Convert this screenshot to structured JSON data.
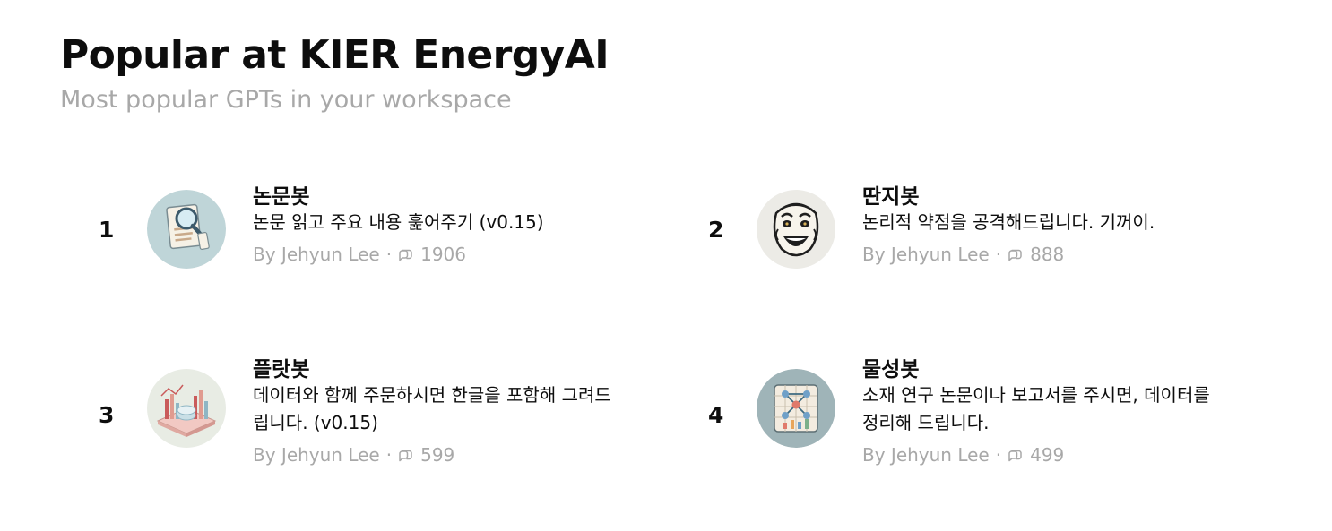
{
  "header": {
    "title": "Popular at KIER EnergyAI",
    "subtitle": "Most popular GPTs in your workspace"
  },
  "gpts": [
    {
      "rank": "1",
      "name": "논문봇",
      "description": "논문 읽고 주요 내용 훑어주기 (v0.15)",
      "author": "By Jehyun Lee",
      "separator": "·",
      "conversations": "1906",
      "icon": "magnifier-document-icon"
    },
    {
      "rank": "2",
      "name": "딴지봇",
      "description": "논리적 약점을 공격해드립니다. 기꺼이.",
      "author": "By Jehyun Lee",
      "separator": "·",
      "conversations": "888",
      "icon": "grinning-mask-icon"
    },
    {
      "rank": "3",
      "name": "플랏봇",
      "description": "데이터와 함께 주문하시면 한글을 포함해 그려드립니다. (v0.15)",
      "author": "By Jehyun Lee",
      "separator": "·",
      "conversations": "599",
      "icon": "bar-chart-isometric-icon"
    },
    {
      "rank": "4",
      "name": "물성봇",
      "description": "소재 연구 논문이나 보고서를 주시면, 데이터를 정리해 드립니다.",
      "author": "By Jehyun Lee",
      "separator": "·",
      "conversations": "499",
      "icon": "molecule-chart-icon"
    }
  ],
  "colors": {
    "text": "#0d0d0d",
    "muted": "#a8a8a8",
    "background": "#ffffff"
  }
}
